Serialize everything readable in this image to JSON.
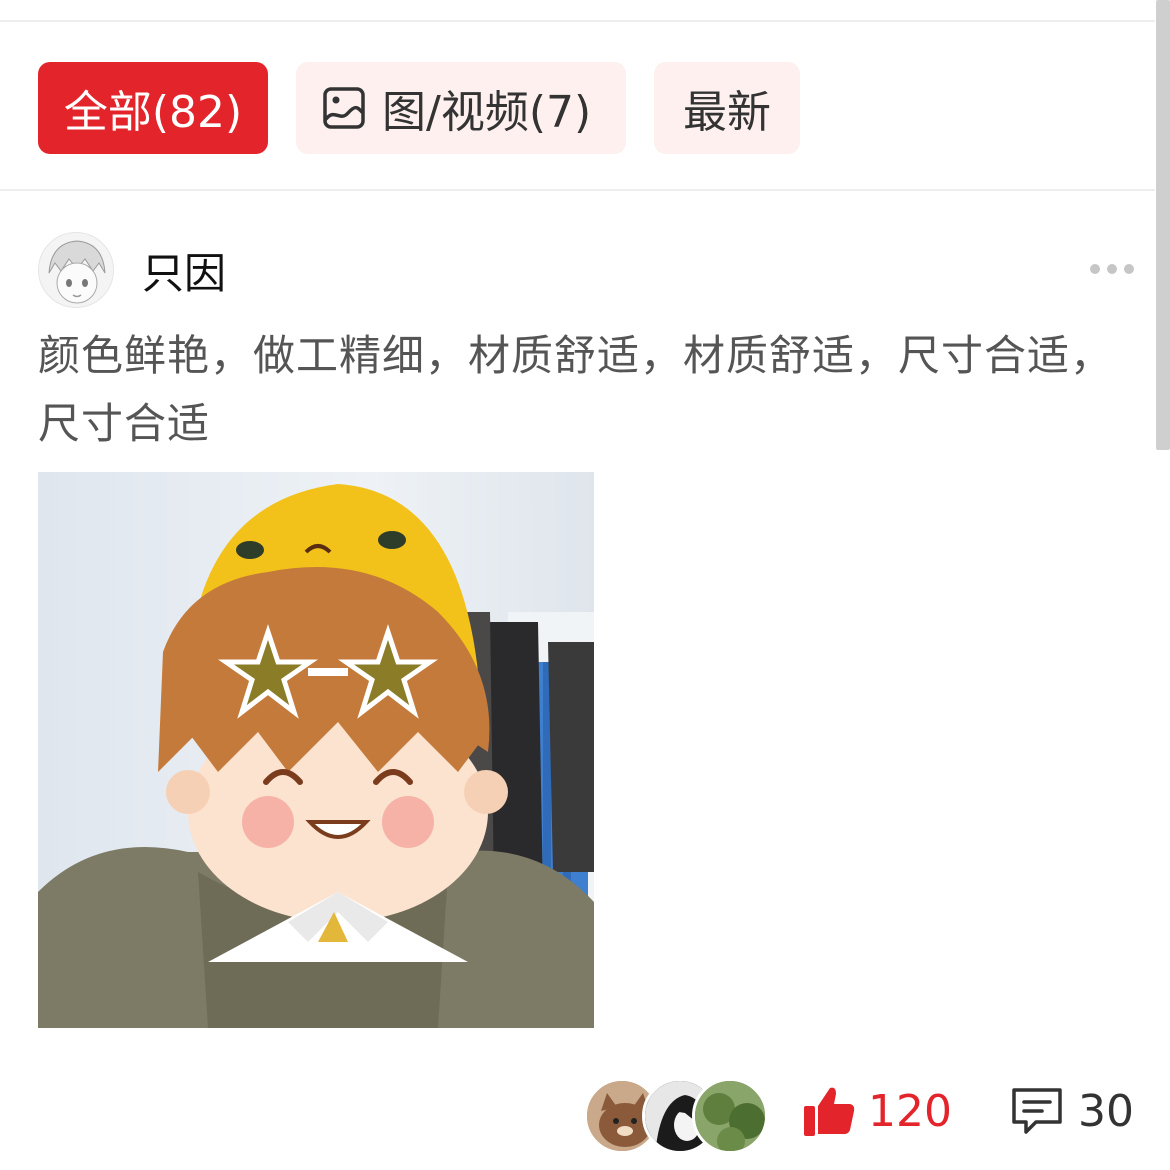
{
  "filters": {
    "all_label": "全部(82)",
    "media_label": "图/视频(7)",
    "latest_label": "最新"
  },
  "review": {
    "username": "只因",
    "text": "颜色鲜艳，做工精细，材质舒适，材质舒适，尺寸合适，尺寸合适",
    "like_count": "120",
    "comment_count": "30"
  },
  "icons": {
    "media": "image-icon",
    "more": "more-dots-icon",
    "like": "thumbs-up-icon",
    "comment": "comment-icon"
  },
  "colors": {
    "accent": "#e3242b",
    "chip_bg": "#fdf0ef",
    "text_gray": "#555555"
  }
}
